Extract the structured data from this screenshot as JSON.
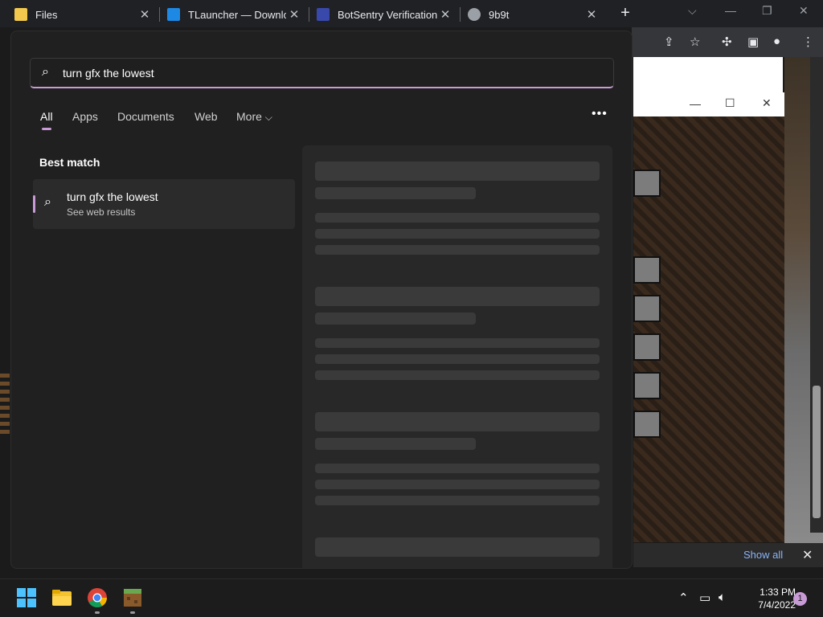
{
  "browser": {
    "tabs": [
      {
        "title": "Files",
        "color": "#f2c94c"
      },
      {
        "title": "TLauncher — Downloa",
        "color": "#1e88e5"
      },
      {
        "title": "BotSentry Verification",
        "color": "#3949ab"
      },
      {
        "title": "9b9t",
        "color": "#9aa0a6"
      }
    ],
    "new_tab": "+",
    "downloads": {
      "show_all": "Show all",
      "close": "✕"
    }
  },
  "search": {
    "query": "turn gfx the lowest",
    "filters": [
      "All",
      "Apps",
      "Documents",
      "Web",
      "More"
    ],
    "more_chevron": "⌵",
    "options": "•••",
    "best_match_label": "Best match",
    "result": {
      "title": "turn gfx the lowest",
      "subtitle": "See web results"
    }
  },
  "taskbar": {
    "time": "1:33 PM",
    "date": "7/4/2022",
    "notification_count": "1",
    "apps": [
      "start-icon",
      "file-explorer-icon",
      "chrome-icon",
      "minecraft-icon"
    ]
  },
  "colors": {
    "accent": "#c89ad6"
  }
}
